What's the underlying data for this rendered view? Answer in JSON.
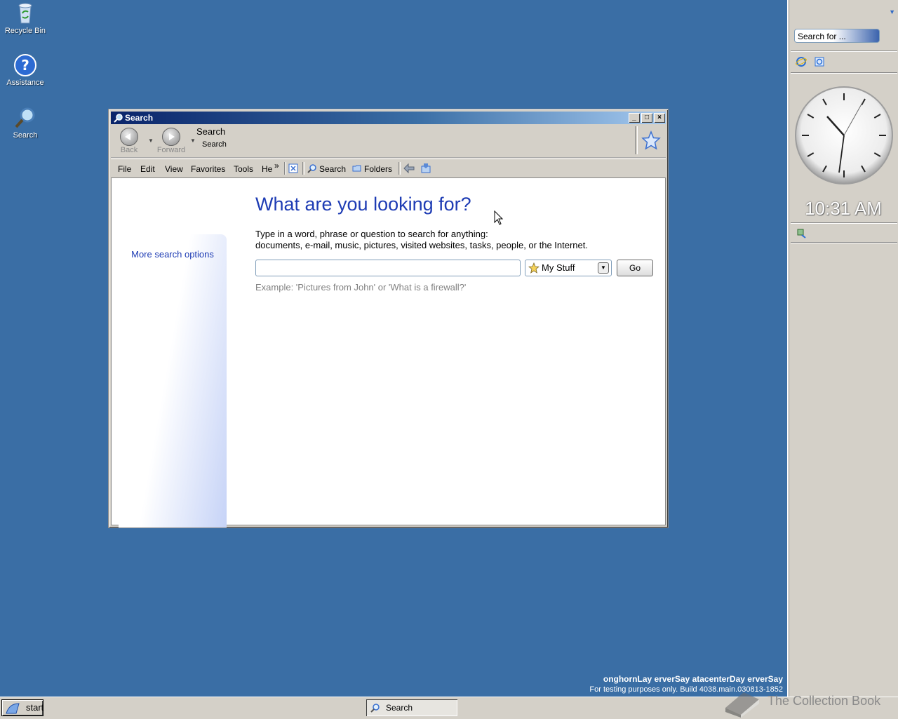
{
  "desktop": {
    "icons": [
      {
        "label": "Recycle Bin",
        "icon": "recycle-bin-icon"
      },
      {
        "label": "Assistance",
        "icon": "help-icon"
      },
      {
        "label": "Search",
        "icon": "search-icon"
      }
    ]
  },
  "window": {
    "title": "Search",
    "buttons": {
      "minimize": "_",
      "maximize": "□",
      "close": "×"
    },
    "nav": {
      "back_label": "Back",
      "forward_label": "Forward",
      "location_title": "Search",
      "location_subtitle": "Search"
    },
    "menu": {
      "file": "File",
      "edit": "Edit",
      "view": "View",
      "favorites": "Favorites",
      "tools": "Tools",
      "help": "He",
      "overflow": "»"
    },
    "toolbar": {
      "search_label": "Search",
      "folders_label": "Folders"
    },
    "content": {
      "more_options": "More search options",
      "heading": "What are you looking for?",
      "desc_line1": "Type in a word, phrase or question to search for anything:",
      "desc_line2": "documents, e-mail, music, pictures, visited websites, tasks, people, or the Internet.",
      "search_value": "",
      "scope_value": "My Stuff",
      "go_label": "Go",
      "example": "Example: 'Pictures from John' or 'What is a firewall?'"
    }
  },
  "sidebar": {
    "search_placeholder": "Search for ...",
    "clock_time": "10:31 AM"
  },
  "watermark": {
    "line1": "onghornLay erverSay atacenterDay erverSay",
    "line2": "For testing purposes only. Build 4038.main.030813-1852"
  },
  "taskbar": {
    "start_label": "start",
    "tasks": [
      {
        "label": "Search"
      }
    ],
    "collection_text": "The Collection Book"
  },
  "colors": {
    "desktop": "#3a6ea5",
    "heading": "#1e3cb4",
    "link": "#1e3cb4"
  }
}
